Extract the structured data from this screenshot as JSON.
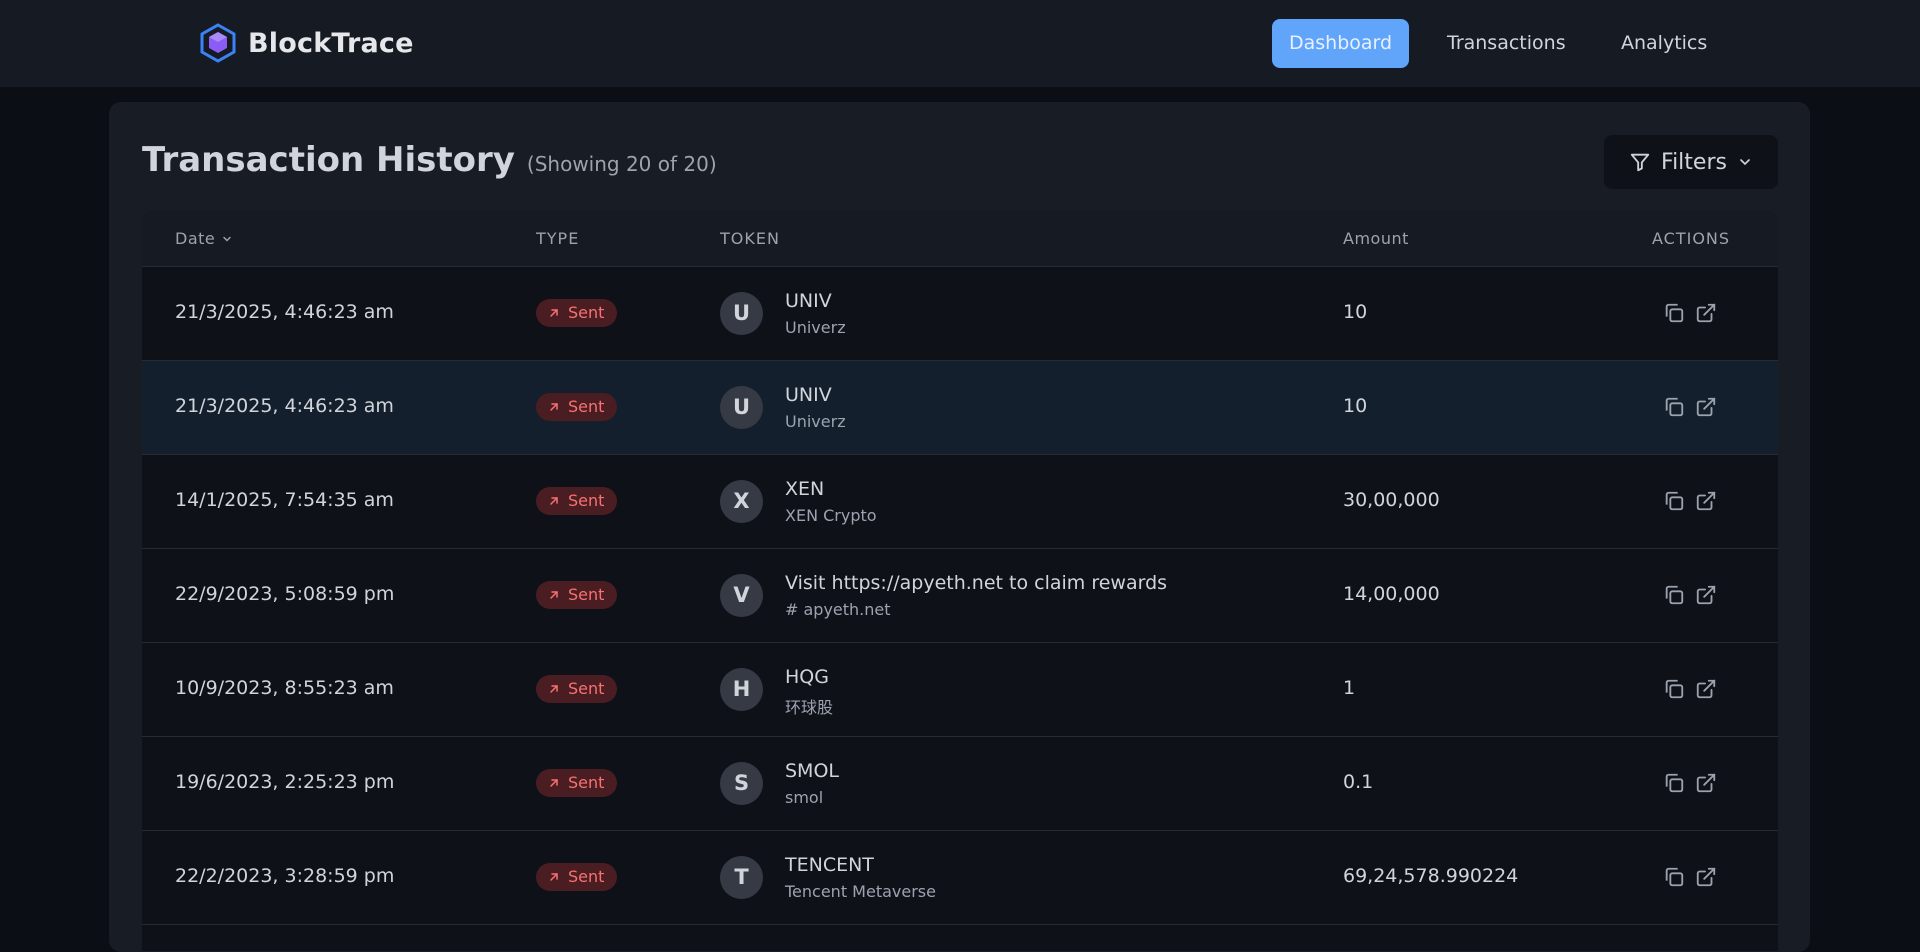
{
  "app": {
    "brand": "BlockTrace",
    "nav": [
      {
        "label": "Dashboard",
        "active": true
      },
      {
        "label": "Transactions",
        "active": false
      },
      {
        "label": "Analytics",
        "active": false
      }
    ]
  },
  "header": {
    "title": "Transaction History",
    "subtitle": "(Showing 20 of 20)",
    "filters_label": "Filters"
  },
  "table": {
    "columns": {
      "date": "Date",
      "type": "TYPE",
      "token": "TOKEN",
      "amount": "Amount",
      "actions": "ACTIONS"
    },
    "rows": [
      {
        "date": "21/3/2025, 4:46:23 am",
        "type": "Sent",
        "avatar": "U",
        "token": "UNIV",
        "token_sub": "Univerz",
        "amount": "10"
      },
      {
        "date": "21/3/2025, 4:46:23 am",
        "type": "Sent",
        "avatar": "U",
        "token": "UNIV",
        "token_sub": "Univerz",
        "amount": "10"
      },
      {
        "date": "14/1/2025, 7:54:35 am",
        "type": "Sent",
        "avatar": "X",
        "token": "XEN",
        "token_sub": "XEN Crypto",
        "amount": "30,00,000"
      },
      {
        "date": "22/9/2023, 5:08:59 pm",
        "type": "Sent",
        "avatar": "V",
        "token": "Visit https://apyeth.net to claim rewards",
        "token_sub": "# apyeth.net",
        "amount": "14,00,000"
      },
      {
        "date": "10/9/2023, 8:55:23 am",
        "type": "Sent",
        "avatar": "H",
        "token": "HQG",
        "token_sub": "环球股",
        "amount": "1"
      },
      {
        "date": "19/6/2023, 2:25:23 pm",
        "type": "Sent",
        "avatar": "S",
        "token": "SMOL",
        "token_sub": "smol",
        "amount": "0.1"
      },
      {
        "date": "22/2/2023, 3:28:59 pm",
        "type": "Sent",
        "avatar": "T",
        "token": "TENCENT",
        "token_sub": "Tencent Metaverse",
        "amount": "69,24,578.990224"
      }
    ]
  },
  "colors": {
    "accent": "#60a5fa",
    "sent_badge_bg": "#4a1d22",
    "sent_badge_text": "#f87171",
    "logo": "#6366f1"
  },
  "icons": {
    "logo": "hexagon-cube-icon",
    "filter": "filter-funnel-icon",
    "chevron": "chevron-down-icon",
    "sent": "arrow-up-right-icon",
    "copy": "copy-icon",
    "external": "external-link-icon"
  }
}
